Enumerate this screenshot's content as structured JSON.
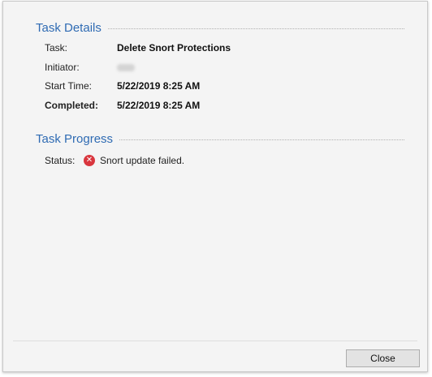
{
  "task_details": {
    "title": "Task Details",
    "task_label": "Task:",
    "task_value": "Delete Snort Protections",
    "initiator_label": "Initiator:",
    "start_label": "Start Time:",
    "start_value": "5/22/2019 8:25 AM",
    "completed_label": "Completed:",
    "completed_value": "5/22/2019 8:25 AM"
  },
  "task_progress": {
    "title": "Task Progress",
    "status_label": "Status:",
    "status_icon": "error-icon",
    "status_text": "Snort update failed."
  },
  "footer": {
    "close_label": "Close"
  }
}
